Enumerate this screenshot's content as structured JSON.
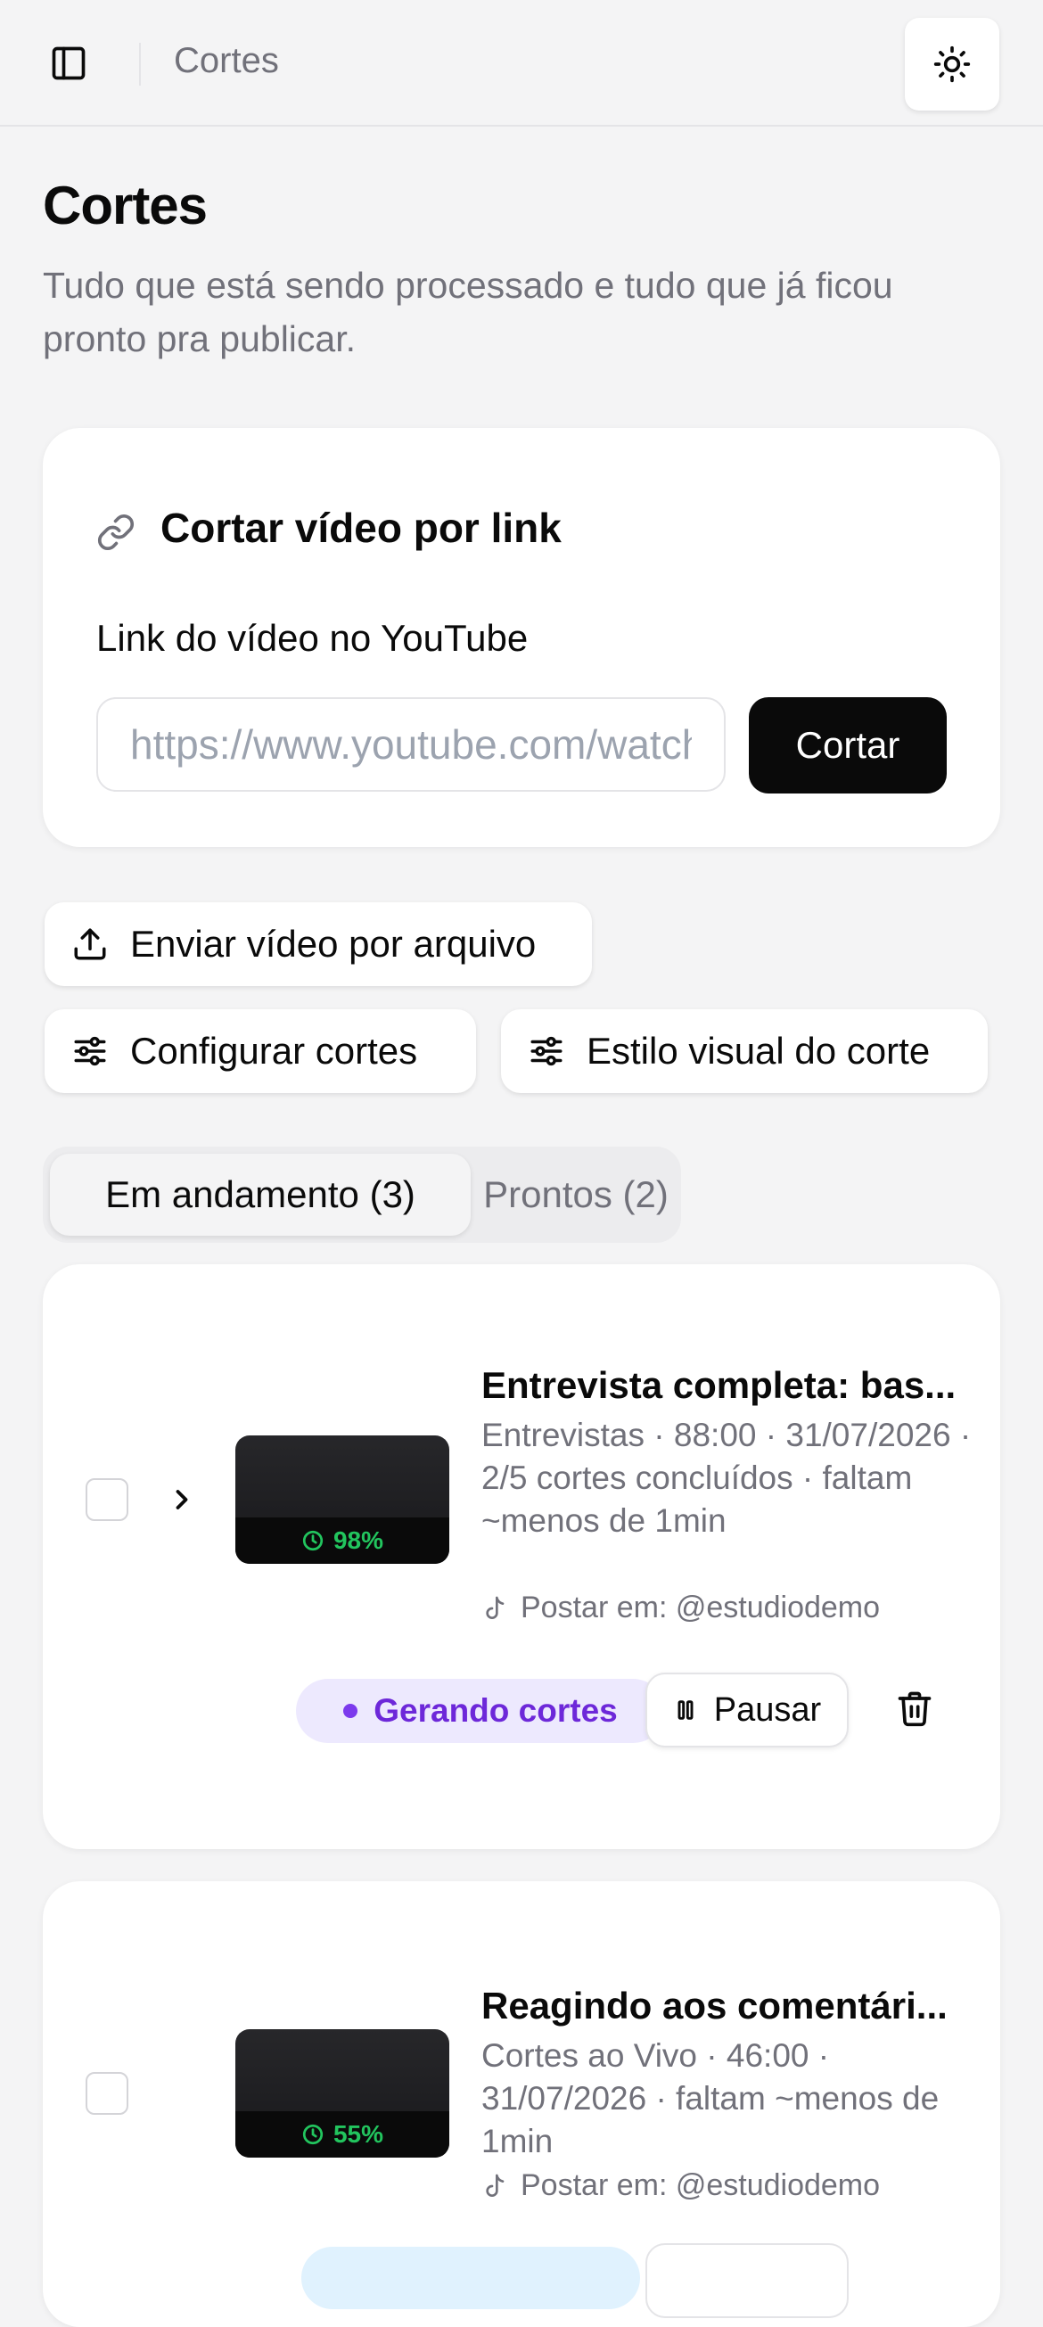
{
  "header": {
    "breadcrumb_title": "Cortes",
    "sidebar_toggle_icon": "sidebar-icon",
    "theme_icon": "sun-icon"
  },
  "page": {
    "title": "Cortes",
    "subtitle": "Tudo que está sendo processado e tudo que já ficou pronto pra publicar."
  },
  "link_card": {
    "title": "Cortar vídeo por link",
    "field_label": "Link do vídeo no YouTube",
    "placeholder": "https://www.youtube.com/watch?v=...",
    "submit_label": "Cortar"
  },
  "actions": {
    "upload_label": "Enviar vídeo por arquivo",
    "config_label": "Configurar cortes",
    "style_label": "Estilo visual do corte"
  },
  "tabs": {
    "in_progress": "Em andamento (3)",
    "ready": "Prontos (2)"
  },
  "jobs": [
    {
      "title": "Entrevista completa: bas...",
      "meta": "Entrevistas · 88:00 · 31/07/2026 · 2/5 cortes concluídos · faltam ~menos de 1min",
      "post_to": "Postar em: @estudiodemo",
      "progress": "98%",
      "status": "Gerando cortes",
      "pause_label": "Pausar",
      "status_color": "#6d28d9"
    },
    {
      "title": "Reagindo aos comentári...",
      "meta": "Cortes ao Vivo · 46:00 · 31/07/2026 · faltam ~menos de 1min",
      "post_to": "Postar em: @estudiodemo",
      "progress": "55%"
    }
  ],
  "colors": {
    "background": "#f4f4f5",
    "primary": "#0a0a0a",
    "muted": "#71717a",
    "progress": "#22c55e",
    "status_bg": "#ede9fe"
  }
}
